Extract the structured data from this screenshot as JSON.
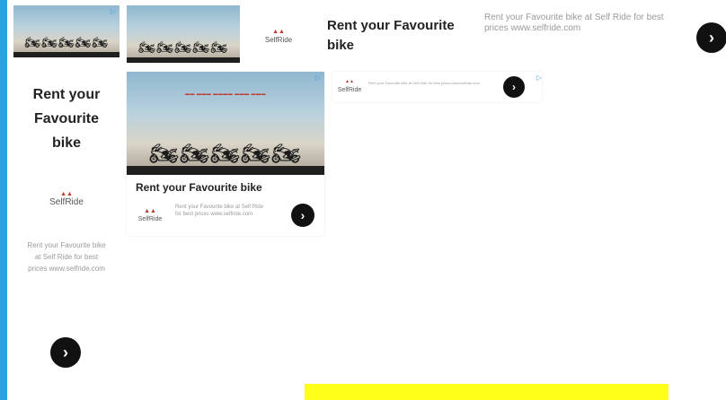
{
  "ads": {
    "headline": "Rent your Favourite bike",
    "headline_lines": [
      "Rent your",
      "Favourite",
      "bike"
    ],
    "description": "Rent your Favourite bike at Self Ride for best prices www.selfride.com",
    "description_short": "Rent your Favourite bike at Self Ride for best prices www.selfride.com",
    "brand": "SelfRide",
    "go_glyph": "›",
    "adchoices_glyph": "▷"
  },
  "colors": {
    "edge_bar": "#29a3e0",
    "cta": "#111111",
    "highlight": "#ffff1a"
  }
}
